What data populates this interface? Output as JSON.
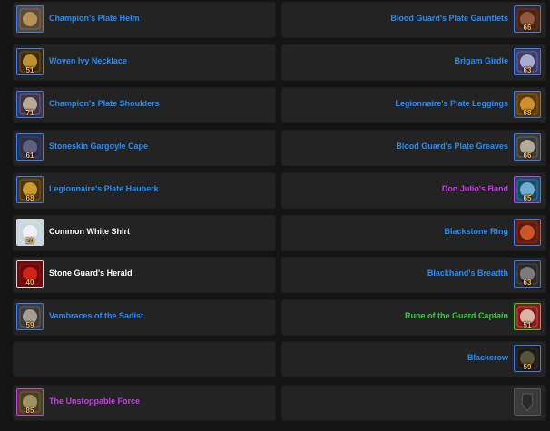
{
  "left": [
    {
      "name": "Champion's Plate Helm",
      "ilvl": "",
      "quality": "rare",
      "icon": "helm-icon",
      "colors": [
        "#5a4a3a",
        "#c8a060"
      ]
    },
    {
      "name": "Woven Ivy Necklace",
      "ilvl": "51",
      "quality": "rare",
      "icon": "necklace-icon",
      "colors": [
        "#3a2a12",
        "#d4a43a"
      ]
    },
    {
      "name": "Champion's Plate Shoulders",
      "ilvl": "71",
      "quality": "rare",
      "icon": "shoulders-icon",
      "colors": [
        "#3e3350",
        "#d0c0a0"
      ]
    },
    {
      "name": "Stoneskin Gargoyle Cape",
      "ilvl": "61",
      "quality": "rare",
      "icon": "cape-icon",
      "colors": [
        "#2a2f4a",
        "#6a6a8a"
      ]
    },
    {
      "name": "Legionnaire's Plate Hauberk",
      "ilvl": "68",
      "quality": "rare",
      "icon": "chest-icon",
      "colors": [
        "#4a3410",
        "#e0b030"
      ]
    },
    {
      "name": "Common White Shirt",
      "ilvl": "20",
      "quality": "common",
      "icon": "shirt-icon",
      "colors": [
        "#c8d8e0",
        "#f4f4f4"
      ]
    },
    {
      "name": "Stone Guard's Herald",
      "ilvl": "40",
      "quality": "common",
      "icon": "tabard-icon",
      "colors": [
        "#6a0a0a",
        "#e02818"
      ]
    },
    {
      "name": "Vambraces of the Sadist",
      "ilvl": "59",
      "quality": "rare",
      "icon": "bracers-icon",
      "colors": [
        "#3a3a3a",
        "#b8b0a0"
      ]
    },
    {
      "name": "",
      "ilvl": "",
      "quality": "empty",
      "icon": "",
      "colors": [
        "#232323",
        "#232323"
      ]
    },
    {
      "name": "The Unstoppable Force",
      "ilvl": "85",
      "quality": "epic",
      "icon": "mace-icon",
      "colors": [
        "#4a4020",
        "#b0a070"
      ]
    }
  ],
  "right": [
    {
      "name": "Blood Guard's Plate Gauntlets",
      "ilvl": "66",
      "quality": "rare",
      "icon": "gauntlets-icon",
      "colors": [
        "#4a2418",
        "#a06040"
      ]
    },
    {
      "name": "Brigam Girdle",
      "ilvl": "63",
      "quality": "rare",
      "icon": "belt-icon",
      "colors": [
        "#3a3a6a",
        "#c0c0e0"
      ]
    },
    {
      "name": "Legionnaire's Plate Leggings",
      "ilvl": "68",
      "quality": "rare",
      "icon": "leggings-icon",
      "colors": [
        "#5a3a10",
        "#e8a030"
      ]
    },
    {
      "name": "Blood Guard's Plate Greaves",
      "ilvl": "66",
      "quality": "rare",
      "icon": "boots-icon",
      "colors": [
        "#3a3a3a",
        "#c8c0a8"
      ]
    },
    {
      "name": "Don Julio's Band",
      "ilvl": "65",
      "quality": "epic",
      "icon": "ring-icon",
      "colors": [
        "#1a4a6a",
        "#80c0e0"
      ]
    },
    {
      "name": "Blackstone Ring",
      "ilvl": "",
      "quality": "rare",
      "icon": "ring-icon",
      "colors": [
        "#5a1a10",
        "#e0602a"
      ]
    },
    {
      "name": "Blackhand's Breadth",
      "ilvl": "63",
      "quality": "rare",
      "icon": "trinket-icon",
      "colors": [
        "#2a2a2a",
        "#8a8a8a"
      ]
    },
    {
      "name": "Rune of the Guard Captain",
      "ilvl": "51",
      "quality": "uncommon",
      "icon": "trinket-icon",
      "colors": [
        "#8a1a1a",
        "#e8d0c0"
      ]
    },
    {
      "name": "Blackcrow",
      "ilvl": "59",
      "quality": "rare",
      "icon": "bow-icon",
      "colors": [
        "#1a1a1a",
        "#6a5a40"
      ]
    },
    {
      "name": "",
      "ilvl": "",
      "quality": "empty",
      "icon": "shield-icon",
      "colors": [
        "#3a3a3a",
        "#4a4a4a"
      ]
    }
  ]
}
